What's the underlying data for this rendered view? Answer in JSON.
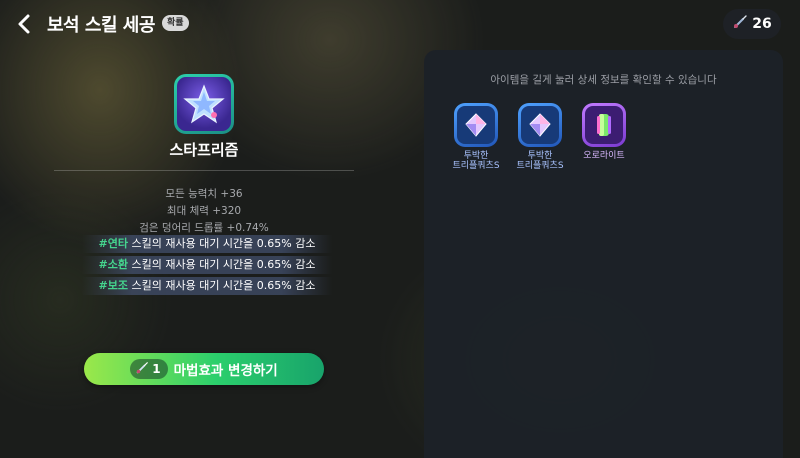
{
  "header": {
    "title": "보석 스킬 세공",
    "help_badge": "확률",
    "currency_count": "26"
  },
  "gem": {
    "name": "스타프리즘",
    "stats": [
      "모든 능력치 +36",
      "최대 체력 +320",
      "검은 덩어리 드롭률 +0.74%"
    ],
    "skill_effects": [
      {
        "tag": "#연타",
        "text": " 스킬의 재사용 대기 시간을 0.65% 감소"
      },
      {
        "tag": "#소환",
        "text": " 스킬의 재사용 대기 시간을 0.65% 감소"
      },
      {
        "tag": "#보조",
        "text": " 스킬의 재사용 대기 시간을 0.65% 감소"
      }
    ]
  },
  "change_button": {
    "cost": "1",
    "label": "마법효과 변경하기"
  },
  "materials_panel": {
    "hint": "아이템을 길게 눌러 상세 정보를 확인할 수 있습니다",
    "items": [
      {
        "name_line1": "투박한",
        "name_line2": "트리플쿼츠S",
        "grade_color": "#4fa2ff"
      },
      {
        "name_line1": "투박한",
        "name_line2": "트리플쿼츠S",
        "grade_color": "#4fa2ff"
      },
      {
        "name_line1": "오로라이트",
        "name_line2": "",
        "grade_color": "#c27bff"
      }
    ]
  },
  "colors": {
    "skill_tag": "#45d48e",
    "button_start": "#9be84a",
    "button_end": "#18a36b"
  }
}
